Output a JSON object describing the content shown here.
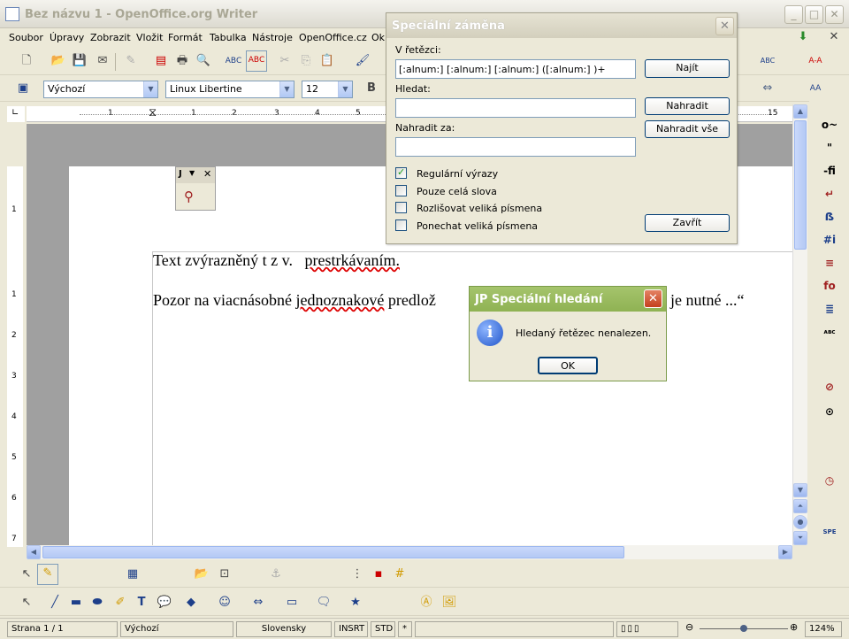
{
  "window": {
    "title": "Bez názvu 1 - OpenOffice.org Writer",
    "min": "_",
    "max": "□",
    "close": "✕",
    "doc_close": "✕"
  },
  "menu": [
    "Soubor",
    "Úpravy",
    "Zobrazit",
    "Vložit",
    "Formát",
    "Tabulka",
    "Nástroje",
    "OpenOffice.cz",
    "Okn"
  ],
  "format_bar": {
    "style": "Výchozí",
    "font": "Linux Libertine",
    "size": "12",
    "bold": "B"
  },
  "document": {
    "line1_a": "Text zvýrazněný t z v.",
    "line1_b": "prestrkávaním.",
    "line2_a": "Pozor na viacnásobné",
    "line2_b": "jednoznakové",
    "line2_c": "predlož",
    "line2_d": "je nutné ...“"
  },
  "mini_toolbar": {
    "title": "J",
    "close": "✕"
  },
  "replace_dialog": {
    "title": "Speciální záměna",
    "close": "✕",
    "in_string_label": "V řetězci:",
    "in_string_value": "[:alnum:] [:alnum:] [:alnum:] ([:alnum:] )+",
    "search_label": "Hledat:",
    "search_value": "",
    "replace_label": "Nahradit za:",
    "replace_value": "",
    "find_button": "Najít",
    "replace_button": "Nahradit",
    "replace_all_button": "Nahradit vše",
    "close_button": "Zavřít",
    "checkboxes": [
      {
        "label": "Regulární výrazy",
        "checked": true
      },
      {
        "label": "Pouze celá slova",
        "checked": false
      },
      {
        "label": "Rozlišovat veliká písmena",
        "checked": false
      },
      {
        "label": "Ponechat veliká písmena",
        "checked": false
      }
    ]
  },
  "message_box": {
    "title": "JP Speciální hledání",
    "close": "✕",
    "text": "Hledaný řetězec nenalezen.",
    "ok": "OK",
    "icon": "i"
  },
  "status": {
    "page": "Strana 1 / 1",
    "style": "Výchozí",
    "language": "Slovensky",
    "insert": "INSRT",
    "selection": "STD",
    "modified": "*",
    "zoom": "124%"
  },
  "ruler_marks": [
    "1",
    "1",
    "2",
    "3",
    "4",
    "5",
    "15"
  ],
  "vruler_marks": [
    "1",
    "1",
    "2",
    "3",
    "4",
    "5",
    "6",
    "7"
  ],
  "sidebar_icons": [
    "o~",
    "\"",
    "-fi",
    "↵",
    "ẞ",
    "#i",
    "≡",
    "fo",
    "≣",
    "ᴀʙᴄ",
    "⊘",
    "⊙",
    "◷",
    "SPE"
  ]
}
